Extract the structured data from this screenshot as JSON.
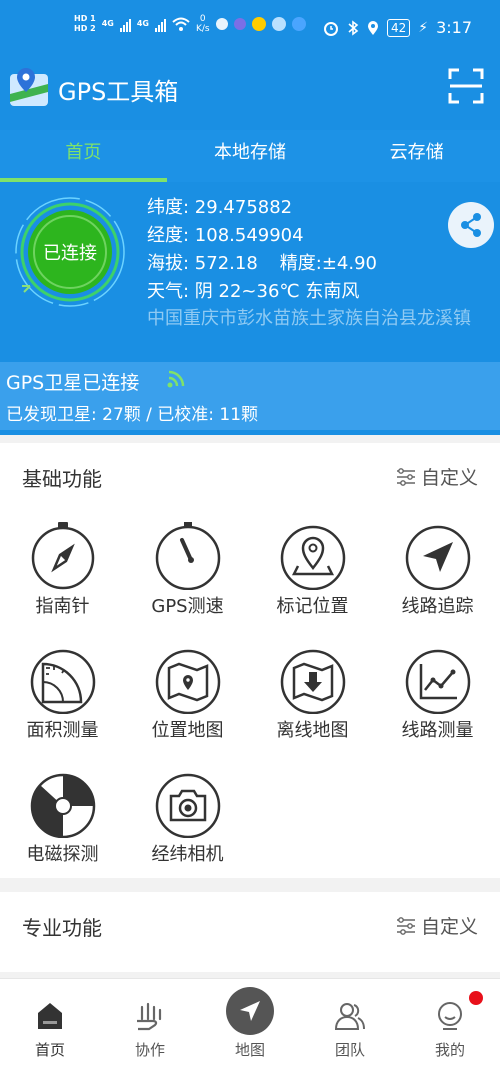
{
  "status_bar": {
    "hd1": "HD 1",
    "hd2": "HD 2",
    "net1": "4G",
    "net2": "4G",
    "speed_value": "0",
    "speed_unit": "K/s",
    "battery": "42",
    "time": "3:17"
  },
  "app": {
    "title": "GPS工具箱"
  },
  "tabs": [
    {
      "label": "首页",
      "active": true
    },
    {
      "label": "本地存储",
      "active": false
    },
    {
      "label": "云存储",
      "active": false
    }
  ],
  "gps": {
    "dial_label": "已连接",
    "latitude": "纬度: 29.475882",
    "longitude": "经度: 108.549904",
    "altitude": "海拔: 572.18",
    "accuracy": "精度:±4.90",
    "weather": "天气: 阴 22~36℃ 东南风",
    "address": "中国重庆市彭水苗族土家族自治县龙溪镇"
  },
  "satellite": {
    "title": "GPS卫星已连接",
    "summary": "已发现卫星: 27颗 / 已校准: 11颗"
  },
  "basic": {
    "header": "基础功能",
    "custom_label": "自定义",
    "items": [
      {
        "label": "指南针",
        "icon": "compass-icon"
      },
      {
        "label": "GPS测速",
        "icon": "speedometer-icon"
      },
      {
        "label": "标记位置",
        "icon": "map-marker-icon"
      },
      {
        "label": "线路追踪",
        "icon": "navigation-arrow-icon"
      },
      {
        "label": "面积测量",
        "icon": "protractor-icon"
      },
      {
        "label": "位置地图",
        "icon": "folded-map-pin-icon"
      },
      {
        "label": "离线地图",
        "icon": "map-download-icon"
      },
      {
        "label": "线路测量",
        "icon": "line-chart-icon"
      },
      {
        "label": "电磁探测",
        "icon": "em-sensor-icon"
      },
      {
        "label": "经纬相机",
        "icon": "camera-icon"
      }
    ]
  },
  "pro": {
    "header": "专业功能",
    "custom_label": "自定义"
  },
  "bottom_nav": [
    {
      "label": "首页",
      "icon": "home-icon"
    },
    {
      "label": "协作",
      "icon": "collaborate-icon"
    },
    {
      "label": "地图",
      "icon": "map-navigate-icon"
    },
    {
      "label": "团队",
      "icon": "team-icon"
    },
    {
      "label": "我的",
      "icon": "profile-icon"
    }
  ],
  "colors": {
    "primary_blue": "#1a8fe3",
    "accent_green": "#7fe26a",
    "connected_green": "#2db51e",
    "notification_red": "#e8101a"
  }
}
